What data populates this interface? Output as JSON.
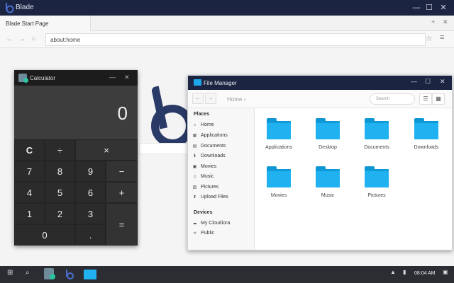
{
  "browser": {
    "app_title": "Blade",
    "tab_label": "Blade Start Page",
    "url": "about:home"
  },
  "calculator": {
    "title": "Calculator",
    "display": "0",
    "keys": [
      "C",
      "÷",
      "×",
      "7",
      "8",
      "9",
      "−",
      "4",
      "5",
      "6",
      "+",
      "1",
      "2",
      "3",
      "=",
      "0",
      "."
    ]
  },
  "file_manager": {
    "title": "File Manager",
    "breadcrumb": "Home",
    "search_placeholder": "Search",
    "places_heading": "Places",
    "places": [
      {
        "label": "Home",
        "icon": "home-icon"
      },
      {
        "label": "Applications",
        "icon": "grid-icon"
      },
      {
        "label": "Documents",
        "icon": "document-icon"
      },
      {
        "label": "Downloads",
        "icon": "download-icon"
      },
      {
        "label": "Movies",
        "icon": "film-icon"
      },
      {
        "label": "Music",
        "icon": "music-icon"
      },
      {
        "label": "Pictures",
        "icon": "picture-icon"
      },
      {
        "label": "Upload Files",
        "icon": "upload-icon"
      }
    ],
    "devices_heading": "Devices",
    "devices": [
      {
        "label": "My Cloudiora",
        "icon": "cloud-drive-icon"
      },
      {
        "label": "Public",
        "icon": "share-icon"
      }
    ],
    "folders": [
      "Applications",
      "Desktop",
      "Documents",
      "Downloads",
      "Movies",
      "Music",
      "Pictures"
    ]
  },
  "taskbar": {
    "time": "08:04 AM"
  }
}
